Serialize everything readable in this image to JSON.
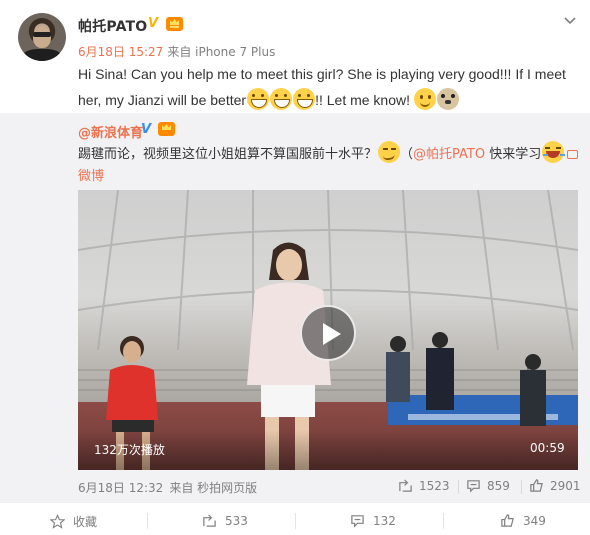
{
  "post": {
    "author": "帕托PATO",
    "time": "6月18日 15:27",
    "source": "来自 iPhone 7 Plus",
    "text_part1": "Hi Sina! Can you help me to meet this girl? She is playing very good!!! If I meet her, my Jianzi will be better",
    "text_part2": "!! Let me know! "
  },
  "repost": {
    "author": "@新浪体育",
    "text_part1": "踢毽而论，视频里这位小姐姐算不算国服前十水平？",
    "text_part2": "（",
    "mention": "@帕托PATO",
    "text_part3": " 快来学习",
    "weibo_label": "微博",
    "video_label": "视频",
    "video": {
      "view_count": "132万次播放",
      "duration": "00:59"
    },
    "time": "6月18日 12:32",
    "source": "来自 秒拍网页版",
    "forwards": "1523",
    "comments": "859",
    "likes": "2901"
  },
  "actions": {
    "favorite": "收藏",
    "forward": "533",
    "comment": "132",
    "like": "349"
  },
  "icons": [
    "chevron-down-icon",
    "verified-icon",
    "vip-crown-icon",
    "play-icon",
    "forward-icon",
    "comment-icon",
    "like-icon",
    "star-icon",
    "link-icon"
  ],
  "colors": {
    "accent": "#eb7350",
    "meta": "#808080",
    "repost_bg": "#f2f2f5"
  }
}
